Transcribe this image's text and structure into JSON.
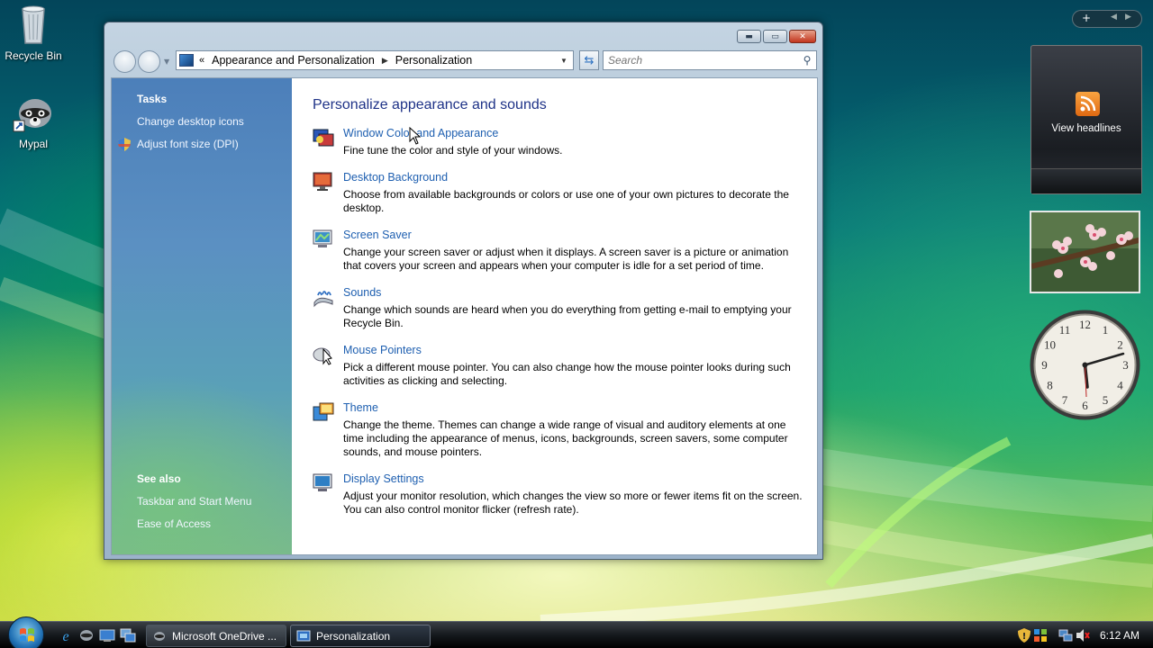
{
  "desktop": {
    "icons": [
      {
        "label": "Recycle Bin"
      },
      {
        "label": "Mypal"
      }
    ]
  },
  "window": {
    "address": {
      "breadcrumb": [
        "Appearance and Personalization",
        "Personalization"
      ]
    },
    "search": {
      "placeholder": "Search"
    },
    "tasks": {
      "heading": "Tasks",
      "links": [
        "Change desktop icons",
        "Adjust font size (DPI)"
      ],
      "see_also_heading": "See also",
      "see_also_links": [
        "Taskbar and Start Menu",
        "Ease of Access"
      ]
    },
    "main": {
      "title": "Personalize appearance and sounds",
      "items": [
        {
          "title": "Window Color and Appearance",
          "desc": "Fine tune the color and style of your windows.",
          "icon": "window-color-icon"
        },
        {
          "title": "Desktop Background",
          "desc": "Choose from available backgrounds or colors or use one of your own pictures to decorate the desktop.",
          "icon": "desktop-background-icon"
        },
        {
          "title": "Screen Saver",
          "desc": "Change your screen saver or adjust when it displays. A screen saver is a picture or animation that covers your screen and appears when your computer is idle for a set period of time.",
          "icon": "screen-saver-icon"
        },
        {
          "title": "Sounds",
          "desc": "Change which sounds are heard when you do everything from getting e-mail to emptying your Recycle Bin.",
          "icon": "sounds-icon"
        },
        {
          "title": "Mouse Pointers",
          "desc": "Pick a different mouse pointer. You can also change how the mouse pointer looks during such activities as clicking and selecting.",
          "icon": "mouse-pointer-icon"
        },
        {
          "title": "Theme",
          "desc": "Change the theme. Themes can change a wide range of visual and auditory elements at one time including the appearance of menus, icons, backgrounds, screen savers, some computer sounds, and mouse pointers.",
          "icon": "theme-icon"
        },
        {
          "title": "Display Settings",
          "desc": "Adjust your monitor resolution, which changes the view so more or fewer items fit on the screen. You can also control monitor flicker (refresh rate).",
          "icon": "display-settings-icon"
        }
      ]
    }
  },
  "sidebar": {
    "feed_label": "View headlines",
    "clock_numbers": [
      "12",
      "1",
      "2",
      "3",
      "4",
      "5",
      "6",
      "7",
      "8",
      "9",
      "10",
      "11"
    ]
  },
  "taskbar": {
    "buttons": [
      {
        "label": "Microsoft OneDrive ..."
      },
      {
        "label": "Personalization"
      }
    ],
    "time": "6:12 AM"
  }
}
